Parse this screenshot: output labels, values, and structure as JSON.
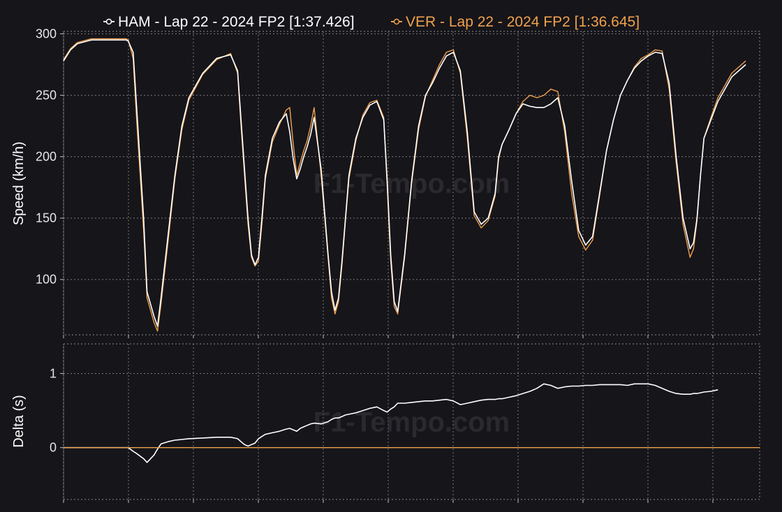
{
  "legend": {
    "entries": [
      {
        "label": "HAM - Lap 22 - 2024 FP2 [1:37.426]",
        "color": "#ffffff"
      },
      {
        "label": "VER - Lap 22 - 2024 FP2 [1:36.645]",
        "color": "#f0a14d"
      }
    ]
  },
  "watermark_text": "F1-Tempo.com",
  "chart_data": [
    {
      "type": "line",
      "title": "",
      "xlabel": "",
      "ylabel": "Speed (km/h)",
      "xlim": [
        0,
        1000
      ],
      "ylim": [
        55,
        302
      ],
      "yticks": [
        100,
        150,
        200,
        250,
        300
      ],
      "ytick_labels": [
        "100",
        "150",
        "200",
        "250",
        "300"
      ],
      "xgrid": [
        91,
        184,
        277,
        370,
        463,
        556,
        649,
        742,
        835,
        928,
        1021
      ],
      "grid": true,
      "legend_position": "top",
      "x": [
        0,
        10,
        20,
        40,
        60,
        80,
        90,
        93,
        100,
        105,
        115,
        120,
        130,
        135,
        140,
        150,
        160,
        170,
        180,
        200,
        220,
        240,
        250,
        255,
        260,
        265,
        270,
        275,
        280,
        285,
        290,
        300,
        310,
        320,
        325,
        330,
        335,
        340,
        345,
        350,
        355,
        360,
        370,
        380,
        385,
        390,
        395,
        400,
        405,
        410,
        420,
        430,
        440,
        450,
        460,
        465,
        470,
        475,
        480,
        490,
        500,
        510,
        520,
        530,
        540,
        550,
        560,
        570,
        580,
        590,
        600,
        610,
        620,
        625,
        630,
        640,
        650,
        660,
        670,
        680,
        690,
        700,
        710,
        720,
        730,
        740,
        750,
        760,
        770,
        780,
        790,
        800,
        810,
        820,
        830,
        840,
        850,
        860,
        870,
        880,
        890,
        900,
        905,
        910,
        915,
        920,
        930,
        940,
        950,
        960,
        970,
        980,
        990,
        1000
      ],
      "series": [
        {
          "name": "HAM - Lap 22 - 2024 FP2 [1:37.426]",
          "color": "#ffffff",
          "values": [
            278,
            287,
            292,
            295,
            295,
            295,
            295,
            294,
            285,
            240,
            150,
            90,
            70,
            62,
            85,
            135,
            185,
            225,
            248,
            268,
            280,
            283,
            270,
            230,
            190,
            150,
            120,
            112,
            118,
            150,
            185,
            215,
            228,
            235,
            220,
            198,
            182,
            190,
            200,
            208,
            218,
            232,
            190,
            120,
            90,
            75,
            85,
            115,
            150,
            185,
            215,
            232,
            242,
            245,
            230,
            180,
            120,
            82,
            74,
            120,
            180,
            225,
            250,
            260,
            272,
            282,
            285,
            270,
            220,
            155,
            145,
            150,
            170,
            200,
            210,
            222,
            235,
            243,
            241,
            240,
            240,
            243,
            248,
            225,
            180,
            140,
            128,
            135,
            170,
            205,
            230,
            250,
            262,
            272,
            278,
            282,
            285,
            284,
            260,
            200,
            150,
            125,
            130,
            150,
            185,
            215,
            230,
            245,
            255,
            265,
            270,
            275
          ]
        },
        {
          "name": "VER - Lap 22 - 2024 FP2 [1:36.645]",
          "color": "#f0a14d",
          "values": [
            279,
            288,
            293,
            296,
            296,
            296,
            296,
            295,
            280,
            230,
            140,
            85,
            65,
            58,
            80,
            130,
            182,
            222,
            246,
            267,
            279,
            284,
            268,
            225,
            185,
            145,
            118,
            111,
            115,
            145,
            182,
            212,
            226,
            238,
            240,
            210,
            185,
            195,
            205,
            213,
            225,
            240,
            185,
            118,
            85,
            72,
            82,
            112,
            148,
            182,
            213,
            234,
            244,
            246,
            232,
            175,
            115,
            78,
            72,
            118,
            178,
            222,
            249,
            262,
            275,
            285,
            287,
            268,
            215,
            152,
            142,
            148,
            168,
            198,
            210,
            222,
            235,
            245,
            250,
            248,
            250,
            255,
            253,
            220,
            170,
            135,
            124,
            132,
            168,
            205,
            230,
            250,
            262,
            273,
            280,
            283,
            287,
            286,
            255,
            195,
            145,
            118,
            125,
            148,
            185,
            215,
            232,
            248,
            258,
            268,
            273,
            278
          ]
        }
      ]
    },
    {
      "type": "line",
      "title": "",
      "xlabel": "",
      "ylabel": "Delta (s)",
      "xlim": [
        0,
        1000
      ],
      "ylim": [
        -0.7,
        1.4
      ],
      "yticks": [
        0,
        1
      ],
      "ytick_labels": [
        "0",
        "1"
      ],
      "grid": true,
      "series": [
        {
          "name": "",
          "color": "#ffffff",
          "values": [
            0,
            0,
            0,
            0,
            0,
            0,
            0,
            0,
            -0.05,
            -0.08,
            -0.15,
            -0.2,
            -0.1,
            -0.02,
            0.05,
            0.08,
            0.1,
            0.11,
            0.12,
            0.13,
            0.14,
            0.14,
            0.12,
            0.08,
            0.04,
            0.02,
            0.04,
            0.06,
            0.12,
            0.15,
            0.18,
            0.2,
            0.22,
            0.25,
            0.26,
            0.24,
            0.22,
            0.26,
            0.28,
            0.3,
            0.32,
            0.33,
            0.32,
            0.35,
            0.38,
            0.4,
            0.4,
            0.42,
            0.44,
            0.45,
            0.47,
            0.5,
            0.53,
            0.55,
            0.5,
            0.48,
            0.52,
            0.55,
            0.6,
            0.6,
            0.61,
            0.62,
            0.63,
            0.63,
            0.64,
            0.65,
            0.63,
            0.58,
            0.6,
            0.62,
            0.64,
            0.65,
            0.65,
            0.66,
            0.66,
            0.68,
            0.7,
            0.73,
            0.76,
            0.8,
            0.86,
            0.84,
            0.8,
            0.82,
            0.83,
            0.83,
            0.84,
            0.84,
            0.85,
            0.85,
            0.85,
            0.85,
            0.84,
            0.86,
            0.86,
            0.86,
            0.84,
            0.8,
            0.76,
            0.73,
            0.72,
            0.72,
            0.73,
            0.73,
            0.74,
            0.75,
            0.76,
            0.78
          ]
        },
        {
          "name": "",
          "color": "#f0a14d",
          "values": [
            0,
            0
          ]
        }
      ]
    }
  ]
}
